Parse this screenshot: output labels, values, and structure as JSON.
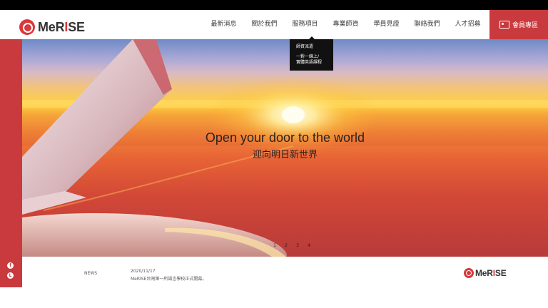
{
  "brand": {
    "prefix": "MeR",
    "highlight": "I",
    "suffix": "SE"
  },
  "nav": {
    "items": [
      {
        "label": "最新消息"
      },
      {
        "label": "關於我們"
      },
      {
        "label": "服務項目"
      },
      {
        "label": "專業師資"
      },
      {
        "label": "學員見證"
      },
      {
        "label": "聯絡我們"
      },
      {
        "label": "人才招募"
      }
    ],
    "member_label": "會員專區"
  },
  "dropdown": {
    "items": [
      {
        "label": "師資派遣"
      },
      {
        "label": "一對一線上/"
      },
      {
        "label": "實體英語課程"
      }
    ]
  },
  "social": {
    "icons": [
      "facebook-icon",
      "line-icon"
    ],
    "glyphs": [
      "f",
      "L"
    ]
  },
  "hero": {
    "title_en": "Open your door to the world",
    "title_zh": "迎向明日新世界",
    "slides": [
      "1",
      "2",
      "3",
      "4"
    ]
  },
  "news": {
    "label": "NEWS",
    "date": "2020/11/17",
    "title": "MeRISE台灣第一所語言學校正式開幕。"
  },
  "colors": {
    "accent": "#c93a3e",
    "topbar": "#000000",
    "dropdown_bg": "#111111"
  }
}
